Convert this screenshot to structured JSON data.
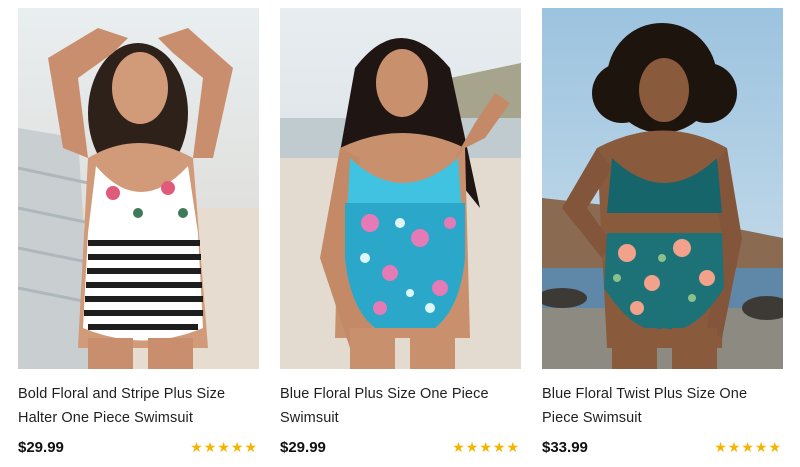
{
  "products": [
    {
      "title": "Bold Floral and Stripe Plus Size Halter One Piece Swimsuit",
      "price": "$29.99",
      "rating": 5,
      "image_icon": "swimsuit-model-photo",
      "accent": "#ffffff"
    },
    {
      "title": "Blue Floral Plus Size One Piece Swimsuit",
      "price": "$29.99",
      "rating": 5,
      "image_icon": "swimsuit-model-photo",
      "accent": "#2bb6d6"
    },
    {
      "title": "Blue Floral Twist Plus Size One Piece Swimsuit",
      "price": "$33.99",
      "rating": 5,
      "image_icon": "swimsuit-model-photo",
      "accent": "#16656b"
    }
  ],
  "colors": {
    "star": "#f5b400",
    "price": "#111111"
  }
}
